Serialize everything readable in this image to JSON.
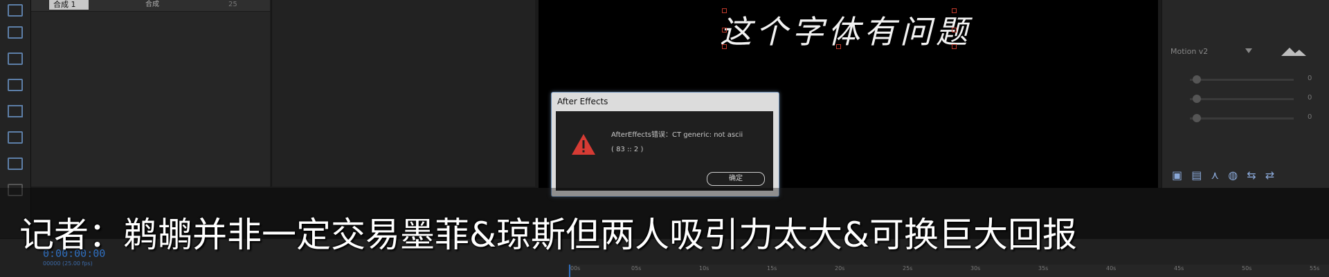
{
  "project": {
    "comp_name": "合成 1",
    "comp_type": "合成",
    "comp_number": "25"
  },
  "viewer": {
    "text_layer": "这个字体有问题"
  },
  "dialog": {
    "title": "After Effects",
    "message": "AfterEffects错误：CT generic: not ascii",
    "code": "( 83 :: 2 )",
    "ok_label": "确定",
    "icon": "warning-icon"
  },
  "right_panel": {
    "motion_select": "Motion v2",
    "slider_values": [
      "0",
      "0",
      "0"
    ]
  },
  "timeline": {
    "timecode": "0:00:00:00",
    "timecode_sub": "00000 (25.00 fps)",
    "ruler_ticks": [
      "00s",
      "05s",
      "10s",
      "15s",
      "20s",
      "25s",
      "30s",
      "35s",
      "40s",
      "45s",
      "50s",
      "55s"
    ]
  },
  "subtitle": {
    "text": "记者：鹈鹕并非一定交易墨菲&琼斯但两人吸引力太大&可换巨大回报"
  },
  "colors": {
    "accent_blue": "#2f6fc0",
    "warning_red": "#d63b34",
    "handle_red": "#c0392b"
  }
}
